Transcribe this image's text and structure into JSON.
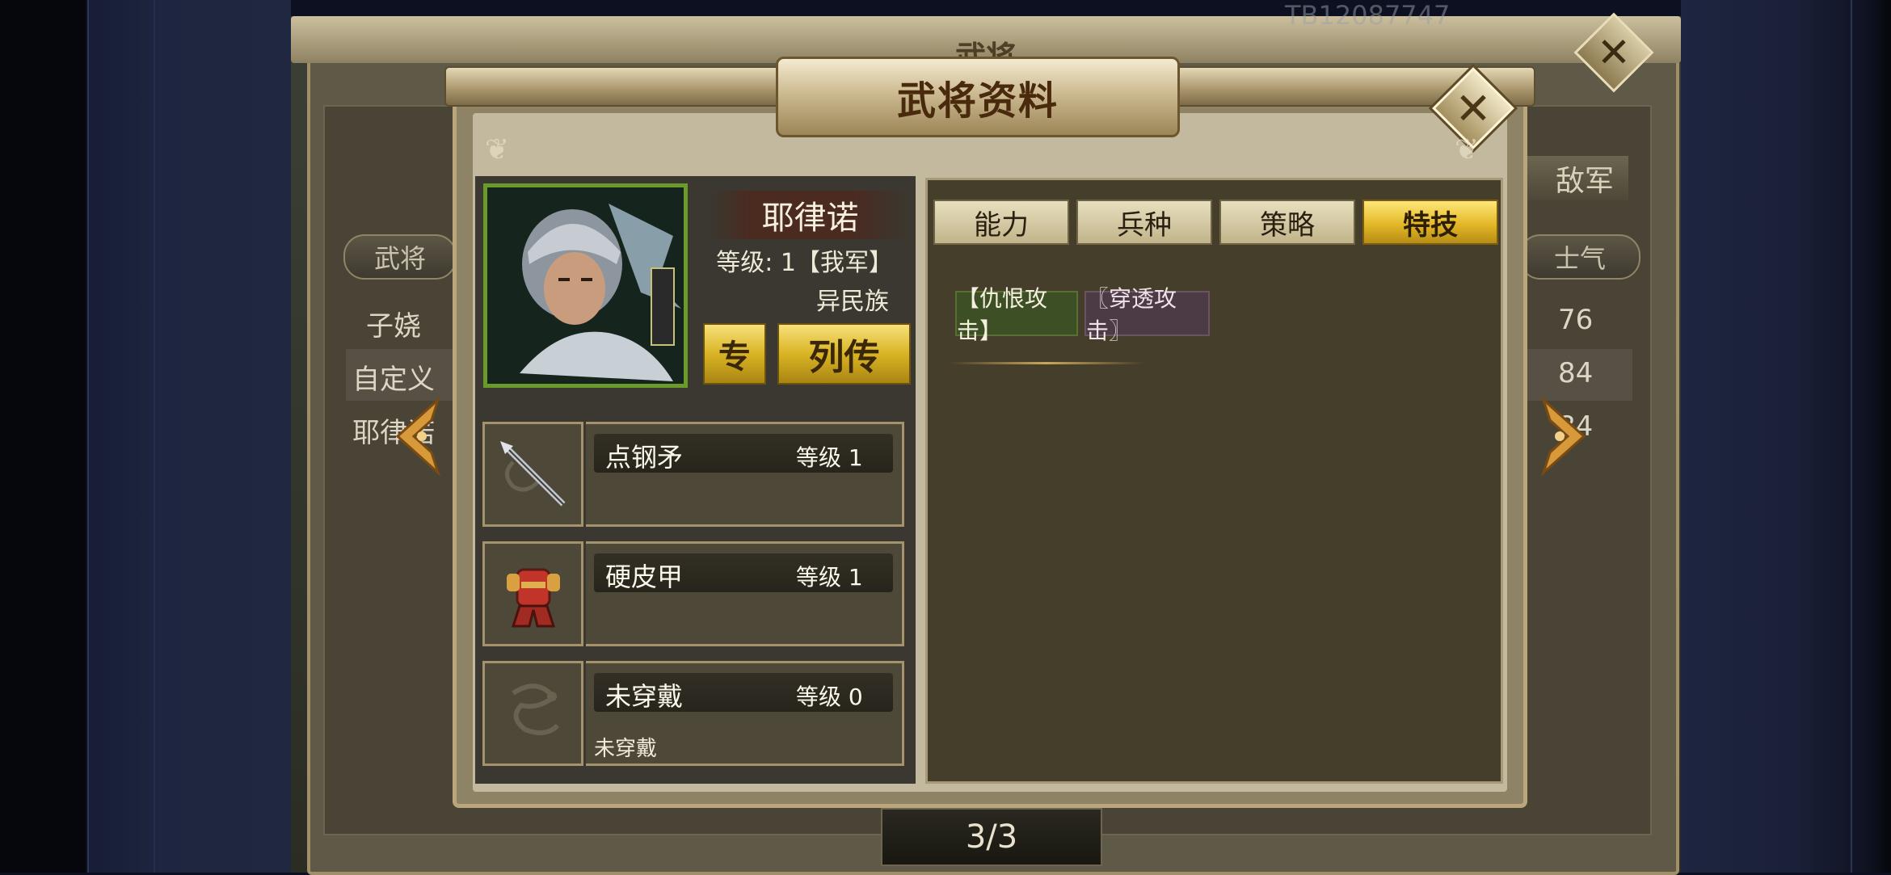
{
  "background_window": {
    "title": "武将",
    "id_text": "TB12087747",
    "enemy_tab": "敌军",
    "columns": {
      "general": "武将",
      "morale": "士气"
    },
    "rows": [
      {
        "name": "子娆",
        "morale": "76"
      },
      {
        "name": "自定义",
        "morale": "84"
      },
      {
        "name": "耶律诺",
        "morale": "84"
      }
    ],
    "pager": "3/3"
  },
  "modal": {
    "title": "武将资料",
    "close_symbol": "✕",
    "general": {
      "name": "耶律诺",
      "level_label": "等级:",
      "level_value": "1【我军】",
      "race": "异民族",
      "specialty_button": "专",
      "biography_button": "列传"
    },
    "equipment": [
      {
        "name": "点钢矛",
        "level_label": "等级",
        "level": "1",
        "note": "",
        "icon": "spear-icon"
      },
      {
        "name": "硬皮甲",
        "level_label": "等级",
        "level": "1",
        "note": "",
        "icon": "armor-icon"
      },
      {
        "name": "未穿戴",
        "level_label": "等级",
        "level": "0",
        "note": "未穿戴",
        "icon": "dragon-emblem-icon"
      }
    ],
    "tabs": [
      {
        "label": "能力",
        "active": false
      },
      {
        "label": "兵种",
        "active": false
      },
      {
        "label": "策略",
        "active": false
      },
      {
        "label": "特技",
        "active": true
      }
    ],
    "skills": [
      {
        "label": "【仇恨攻击】",
        "color": "#3d4f24"
      },
      {
        "label": "〖穿透攻击〗",
        "color": "#4c3a45"
      }
    ]
  },
  "colors": {
    "gold": "#e3b827",
    "frame": "#b9a77b",
    "panel": "#453e2b"
  }
}
